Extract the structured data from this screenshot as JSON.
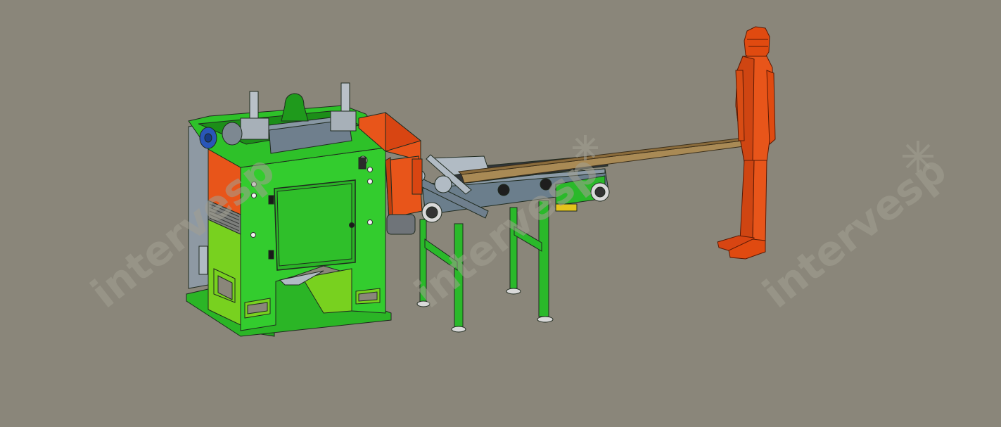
{
  "scene": {
    "background_color": "#8a867a",
    "objects": [
      {
        "name": "cutting-machine",
        "color": "#2fc42a"
      },
      {
        "name": "belt-conveyor",
        "color": "#6b7e8c"
      },
      {
        "name": "wooden-board",
        "color": "#a98a55"
      },
      {
        "name": "human-figure",
        "color": "#e04a10"
      }
    ]
  },
  "watermark": {
    "text": "intervesp",
    "icon": "snowflake-logo-icon"
  }
}
